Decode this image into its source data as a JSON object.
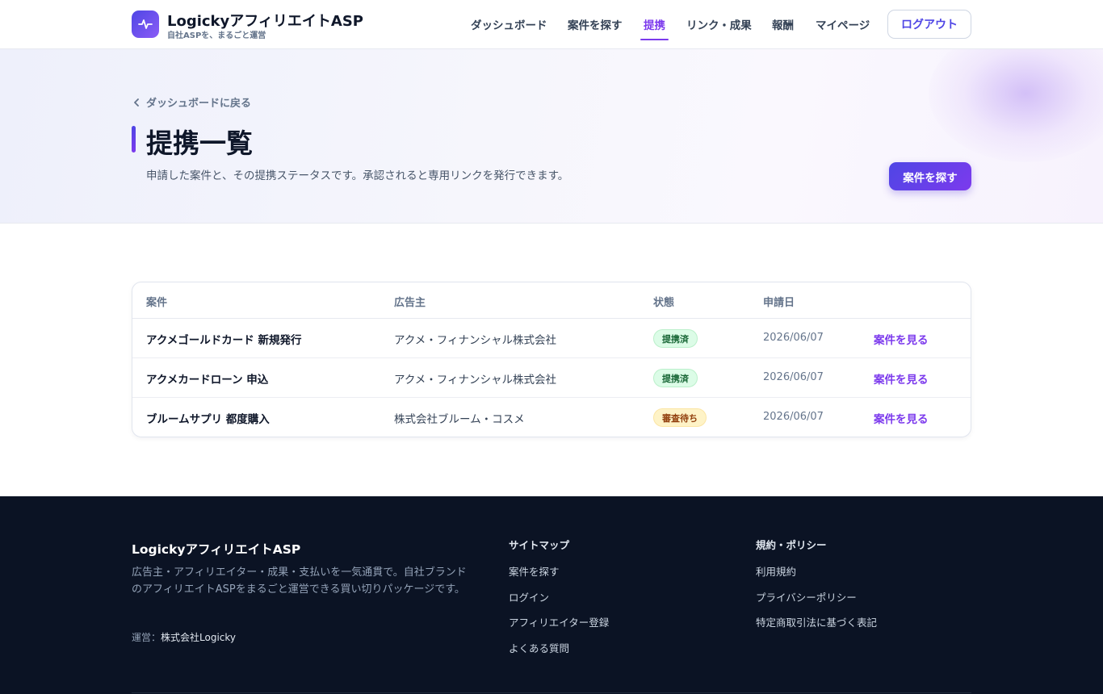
{
  "header": {
    "brand_name": "LogickyアフィリエイトASP",
    "brand_sub": "自社ASPを、まるごと運営",
    "nav": [
      "ダッシュボード",
      "案件を探す",
      "提携",
      "リンク・成果",
      "報酬",
      "マイページ"
    ],
    "active_nav": "提携",
    "logout_label": "ログアウト"
  },
  "hero": {
    "back_label": "ダッシュボードに戻る",
    "title": "提携一覧",
    "description": "申請した案件と、その提携ステータスです。承認されると専用リンクを発行できます。",
    "cta_label": "案件を探す"
  },
  "table": {
    "headers": [
      "案件",
      "広告主",
      "状態",
      "申請日"
    ],
    "rows": [
      {
        "name": "アクメゴールドカード 新規発行",
        "advertiser": "アクメ・フィナンシャル株式会社",
        "status": "提携済",
        "date": "2026/06/07",
        "action": "案件を見る"
      },
      {
        "name": "アクメカードローン 申込",
        "advertiser": "アクメ・フィナンシャル株式会社",
        "status": "提携済",
        "date": "2026/06/07",
        "action": "案件を見る"
      },
      {
        "name": "ブルームサプリ 都度購入",
        "advertiser": "株式会社ブルーム・コスメ",
        "status": "審査待ち",
        "date": "2026/06/07",
        "action": "案件を見る"
      }
    ]
  },
  "footer": {
    "brand": "LogickyアフィリエイトASP",
    "description": "広告主・アフィリエイター・成果・支払いを一気通貫で。自社ブランドのアフィリエイトASPをまるごと運営できる買い切りパッケージです。",
    "operator_label": "運営：",
    "operator_name": "株式会社Logicky",
    "sitemap_title": "サイトマップ",
    "sitemap_links": [
      "案件を探す",
      "ログイン",
      "アフィリエイター登録",
      "よくある質問"
    ],
    "policy_title": "規約・ポリシー",
    "policy_links": [
      "利用規約",
      "プライバシーポリシー",
      "特定商取引法に基づく表記"
    ]
  },
  "colors": {
    "accent": "#7c3aed",
    "brand_gradient_start": "#4f46e5",
    "status_ok_bg": "#dcfce7",
    "status_wait_bg": "#fef3c7",
    "footer_bg": "#0b1324"
  },
  "icons": [
    "pulse-icon",
    "chevron-left-icon"
  ]
}
